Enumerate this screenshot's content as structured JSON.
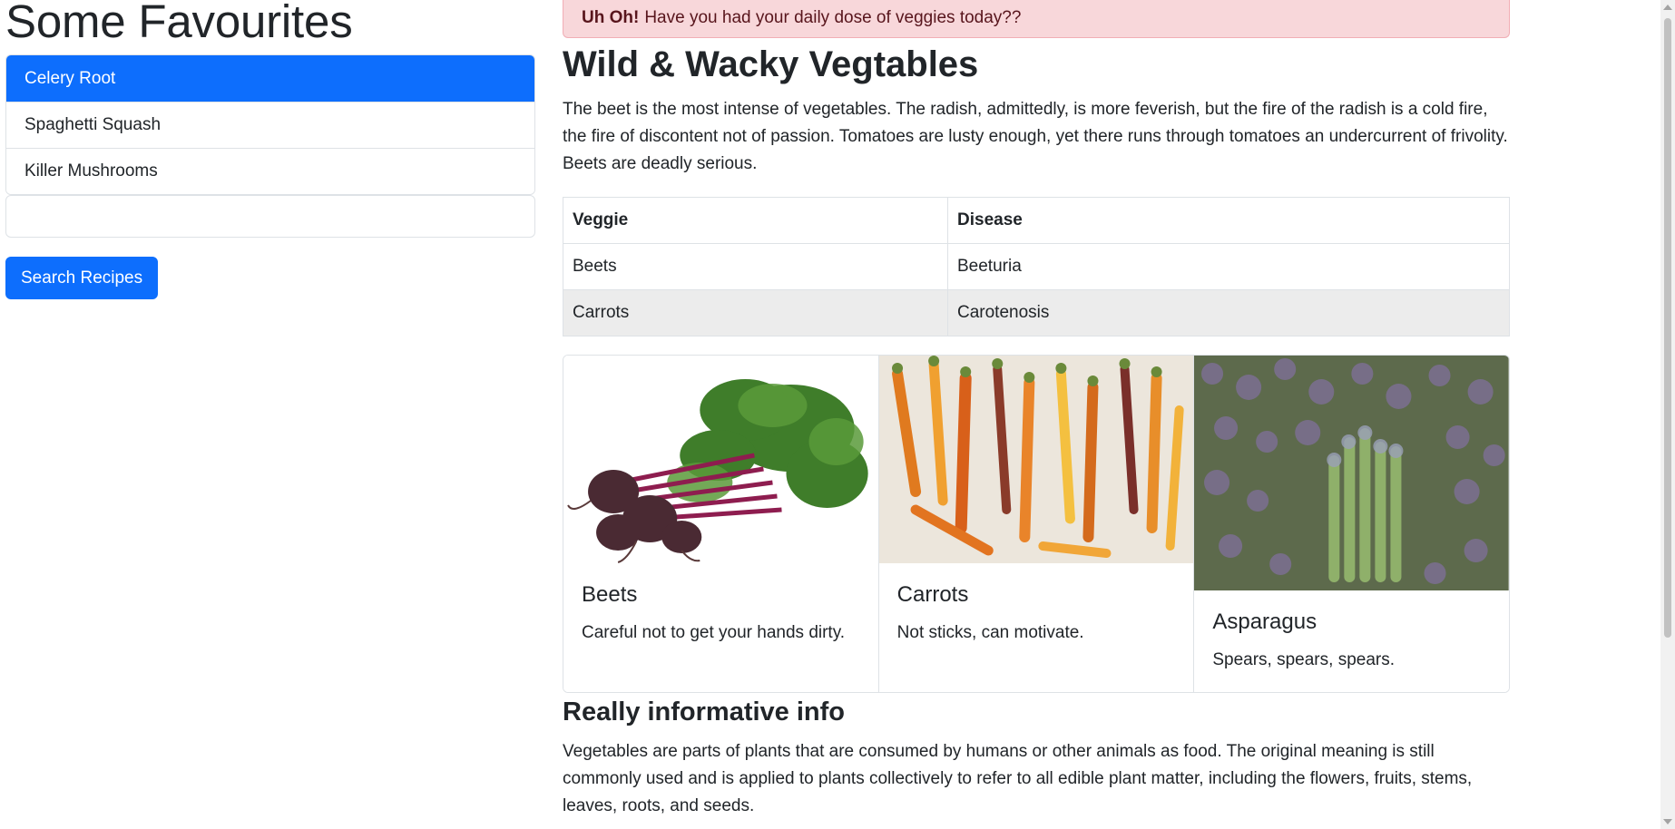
{
  "sidebar": {
    "title": "Some Favourites",
    "items": [
      {
        "label": "Celery Root",
        "active": true
      },
      {
        "label": "Spaghetti Squash",
        "active": false
      },
      {
        "label": "Killer Mushrooms",
        "active": false
      }
    ],
    "search": {
      "value": "",
      "placeholder": ""
    },
    "search_button_label": "Search Recipes"
  },
  "alert": {
    "strong": "Uh Oh!",
    "text": "Have you had your daily dose of veggies today??"
  },
  "main": {
    "title": "Wild & Wacky Vegtables",
    "intro": "The beet is the most intense of vegetables. The radish, admittedly, is more feverish, but the fire of the radish is a cold fire, the fire of discontent not of passion. Tomatoes are lusty enough, yet there runs through tomatoes an undercurrent of frivolity. Beets are deadly serious."
  },
  "table": {
    "headers": [
      "Veggie",
      "Disease"
    ],
    "rows": [
      [
        "Beets",
        "Beeturia"
      ],
      [
        "Carrots",
        "Carotenosis"
      ]
    ]
  },
  "cards": [
    {
      "title": "Beets",
      "text": "Careful not to get your hands dirty.",
      "image": "beets-photo"
    },
    {
      "title": "Carrots",
      "text": "Not sticks, can motivate.",
      "image": "carrots-photo"
    },
    {
      "title": "Asparagus",
      "text": "Spears, spears, spears.",
      "image": "asparagus-photo"
    }
  ],
  "info": {
    "title": "Really informative info",
    "text": "Vegetables are parts of plants that are consumed by humans or other animals as food. The original meaning is still commonly used and is applied to plants collectively to refer to all edible plant matter, including the flowers, fruits, stems, leaves, roots, and seeds."
  },
  "colors": {
    "primary": "#0d6efd",
    "alert_bg": "#f8d7da",
    "alert_text": "#58151c",
    "text": "#212529",
    "border": "#dee2e6",
    "table_stripe": "#ececec"
  }
}
